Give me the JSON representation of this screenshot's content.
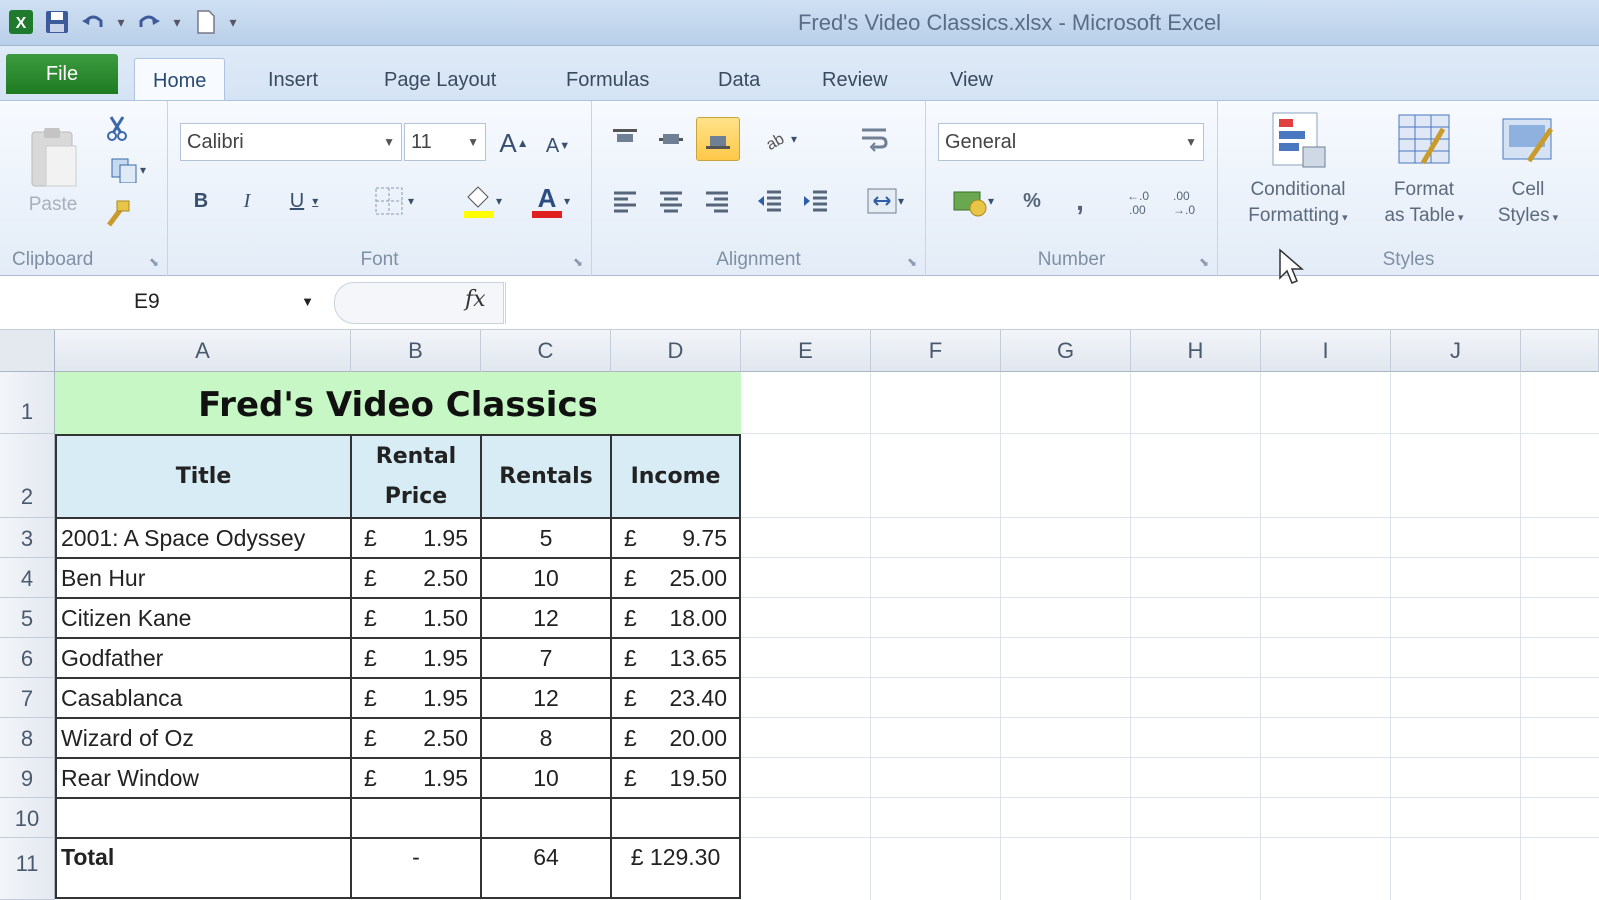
{
  "window": {
    "title": "Fred's Video Classics.xlsx - Microsoft Excel"
  },
  "quick_access": {
    "icons": [
      "excel-logo-icon",
      "save-icon",
      "undo-icon",
      "redo-icon",
      "new-document-icon",
      "customize-icon"
    ]
  },
  "tabs": [
    {
      "label": "File"
    },
    {
      "label": "Home"
    },
    {
      "label": "Insert"
    },
    {
      "label": "Page Layout"
    },
    {
      "label": "Formulas"
    },
    {
      "label": "Data"
    },
    {
      "label": "Review"
    },
    {
      "label": "View"
    }
  ],
  "ribbon": {
    "clipboard": {
      "label": "Clipboard",
      "paste_label": "Paste"
    },
    "font": {
      "label": "Font",
      "font_name": "Calibri",
      "font_size": "11"
    },
    "alignment": {
      "label": "Alignment"
    },
    "number": {
      "label": "Number",
      "format": "General",
      "percent": "%"
    },
    "styles": {
      "label": "Styles",
      "conditional_formatting": [
        "Conditional",
        "Formatting"
      ],
      "format_as_table": [
        "Format",
        "as Table"
      ],
      "cell_styles": [
        "Cell",
        "Styles"
      ]
    }
  },
  "formula_bar": {
    "name_box": "E9",
    "fx": "fx",
    "formula": ""
  },
  "columns": [
    "A",
    "B",
    "C",
    "D",
    "E",
    "F",
    "G",
    "H",
    "I",
    "J"
  ],
  "rows": [
    "1",
    "2",
    "3",
    "4",
    "5",
    "6",
    "7",
    "8",
    "9",
    "10",
    "11"
  ],
  "sheet": {
    "title": "Fred's Video Classics",
    "headers": {
      "title": "Title",
      "rental_price_line1": "Rental",
      "rental_price_line2": "Price",
      "rentals": "Rentals",
      "income": "Income"
    },
    "currency": "£",
    "records": [
      {
        "title": "2001: A Space Odyssey",
        "price": "1.95",
        "rentals": "5",
        "income": "9.75"
      },
      {
        "title": "Ben Hur",
        "price": "2.50",
        "rentals": "10",
        "income": "25.00"
      },
      {
        "title": "Citizen Kane",
        "price": "1.50",
        "rentals": "12",
        "income": "18.00"
      },
      {
        "title": "Godfather",
        "price": "1.95",
        "rentals": "7",
        "income": "13.65"
      },
      {
        "title": "Casablanca",
        "price": "1.95",
        "rentals": "12",
        "income": "23.40"
      },
      {
        "title": "Wizard of Oz",
        "price": "2.50",
        "rentals": "8",
        "income": "20.00"
      },
      {
        "title": "Rear Window",
        "price": "1.95",
        "rentals": "10",
        "income": "19.50"
      }
    ],
    "total": {
      "label": "Total",
      "price": "-",
      "rentals": "64",
      "income": "£ 129.30"
    }
  },
  "colors": {
    "title_fill": "#c6f7c4",
    "header_fill": "#d7ecf5",
    "file_tab": "#2a8a2e"
  }
}
